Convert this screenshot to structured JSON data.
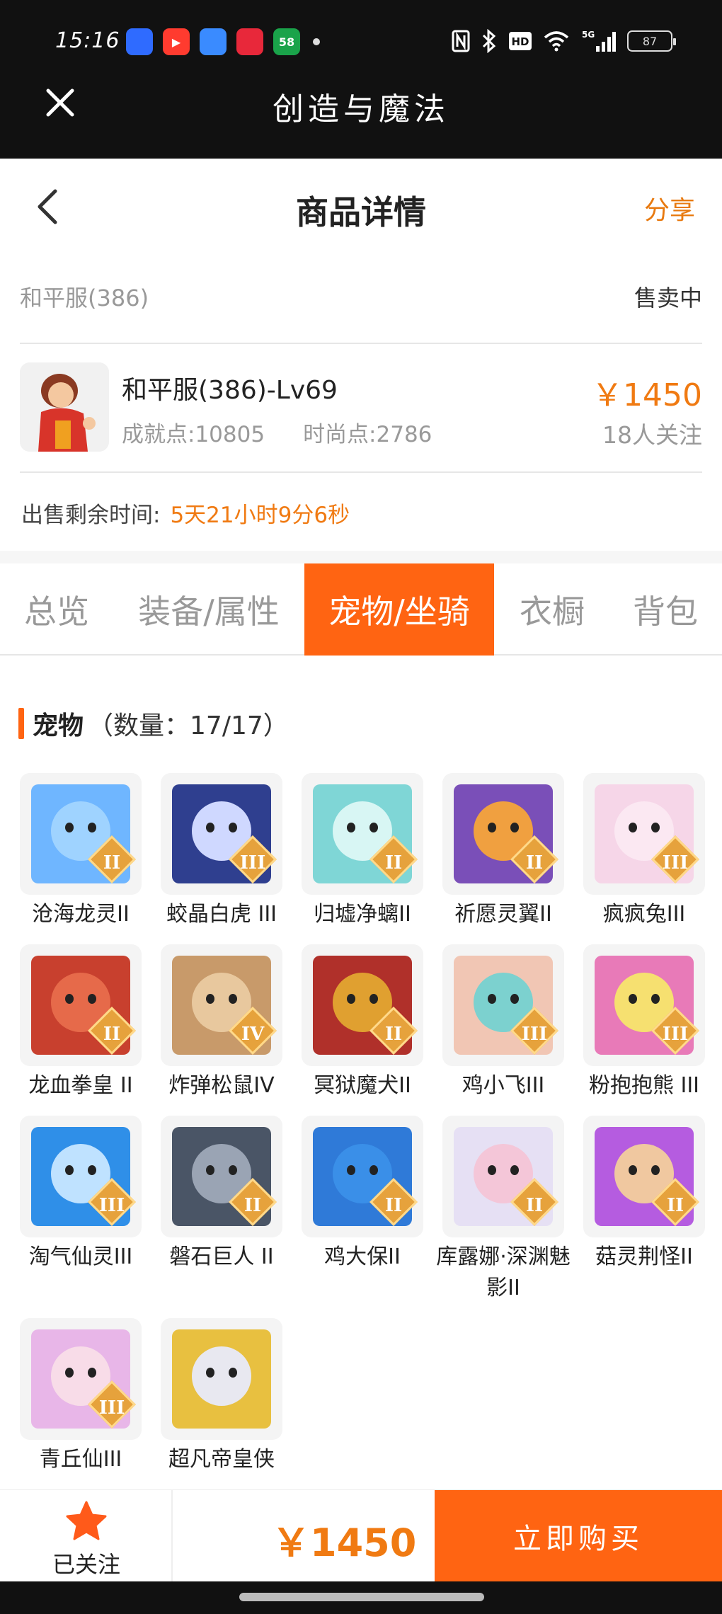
{
  "status_bar": {
    "time": "15:16",
    "apps": [
      {
        "name": "qq-browser-icon",
        "label": "",
        "color": "#2f6bff"
      },
      {
        "name": "video-icon",
        "label": "▶",
        "color": "#ff3b2f"
      },
      {
        "name": "pen-app-icon",
        "label": "",
        "color": "#3a8bff"
      },
      {
        "name": "shopping-app-icon",
        "label": "",
        "color": "#e8283a"
      },
      {
        "name": "58-app-icon",
        "label": "58",
        "color": "#1aa34a"
      }
    ],
    "battery": "87"
  },
  "app_bar": {
    "title": "创造与魔法"
  },
  "header": {
    "title": "商品详情",
    "share": "分享"
  },
  "listing": {
    "server": "和平服(386)",
    "status": "售卖中",
    "character_name": "和平服(386)-Lv69",
    "achievement": "成就点:10805",
    "fashion": "时尚点:2786",
    "price": "￥1450",
    "followers": "18人关注",
    "remain_label": "出售剩余时间:",
    "remain_value": "5天21小时9分6秒"
  },
  "tabs": [
    {
      "label": "总览",
      "active": false
    },
    {
      "label": "装备/属性",
      "active": false
    },
    {
      "label": "宠物/坐骑",
      "active": true
    },
    {
      "label": "衣橱",
      "active": false
    },
    {
      "label": "背包",
      "active": false
    }
  ],
  "pets_section": {
    "title": "宠物",
    "count": "（数量：17/17）",
    "pets": [
      {
        "name": "沧海龙灵II",
        "badge": "II",
        "color": "#6fb6ff",
        "face": "#9fd3ff"
      },
      {
        "name": "蛟晶白虎 III",
        "badge": "III",
        "color": "#2f3f8f",
        "face": "#cfd8ff"
      },
      {
        "name": "归墟净螭II",
        "badge": "II",
        "color": "#7fd6d6",
        "face": "#d8f6f4"
      },
      {
        "name": "祈愿灵翼II",
        "badge": "II",
        "color": "#7a4fb8",
        "face": "#f0a040"
      },
      {
        "name": "疯疯兔III",
        "badge": "III",
        "color": "#f6d6e8",
        "face": "#fbe8f2"
      },
      {
        "name": "龙血拳皇 II",
        "badge": "II",
        "color": "#c8402e",
        "face": "#e66a4a"
      },
      {
        "name": "炸弹松鼠IV",
        "badge": "IV",
        "color": "#c89a6a",
        "face": "#e8c89e"
      },
      {
        "name": "冥狱魔犬II",
        "badge": "II",
        "color": "#b0302a",
        "face": "#e0a030"
      },
      {
        "name": "鸡小飞III",
        "badge": "III",
        "color": "#f1c6b4",
        "face": "#7cd1cf"
      },
      {
        "name": "粉抱抱熊 III",
        "badge": "III",
        "color": "#e87ab8",
        "face": "#f6e070"
      },
      {
        "name": "淘气仙灵III",
        "badge": "III",
        "color": "#2f8fe8",
        "face": "#bfe2ff"
      },
      {
        "name": "磐石巨人 II",
        "badge": "II",
        "color": "#4a5566",
        "face": "#9aa4b4"
      },
      {
        "name": "鸡大保II",
        "badge": "II",
        "color": "#2f7ad8",
        "face": "#3a8fe8"
      },
      {
        "name": "库露娜·深渊魅影II",
        "badge": "II",
        "color": "#e6e0f4",
        "face": "#f4c6d8"
      },
      {
        "name": "菇灵荆怪II",
        "badge": "II",
        "color": "#b55ce0",
        "face": "#f0c8a0"
      },
      {
        "name": "青丘仙III",
        "badge": "III",
        "color": "#e8b6e8",
        "face": "#f8dce8"
      },
      {
        "name": "超凡帝皇侠",
        "badge": "",
        "color": "#e8c040",
        "face": "#e8e8f0"
      }
    ]
  },
  "bottom_bar": {
    "follow_label": "已关注",
    "price": "￥1450",
    "buy_label": "立即购买"
  }
}
